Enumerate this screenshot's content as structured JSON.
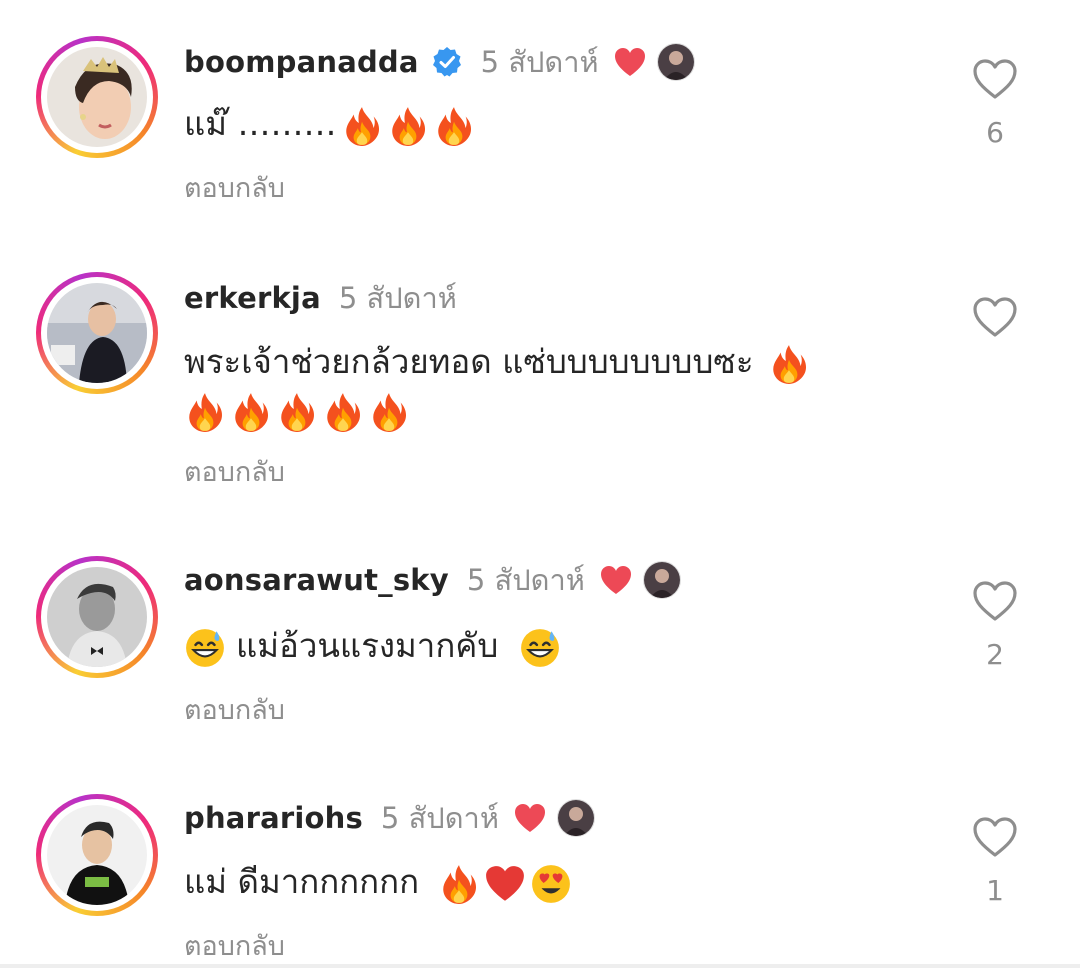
{
  "comments": [
    {
      "username": "boompanadda",
      "verified": true,
      "time": "5 สัปดาห์",
      "liked_by_author": true,
      "text": "แม๊ ………",
      "emoji": [
        "fire",
        "fire",
        "fire"
      ],
      "reply_label": "ตอบกลับ",
      "likes": "6"
    },
    {
      "username": "erkerkja",
      "verified": false,
      "time": "5 สัปดาห์",
      "liked_by_author": false,
      "text": "พระเจ้าช่วยกล้วยทอด แซ่บบบบบบบบซะ",
      "text_line2": "",
      "emoji": [
        "fire",
        "fire",
        "fire",
        "fire",
        "fire",
        "fire"
      ],
      "reply_label": "ตอบกลับ",
      "likes": ""
    },
    {
      "username": "aonsarawut_sky",
      "verified": false,
      "time": "5 สัปดาห์",
      "liked_by_author": true,
      "text": "แม่อ้วนแรงมากคับ",
      "emoji": [
        "grin-sweat",
        "grin-sweat"
      ],
      "reply_label": "ตอบกลับ",
      "likes": "2"
    },
    {
      "username": "pharariohs",
      "verified": false,
      "time": "5 สัปดาห์",
      "liked_by_author": true,
      "text": "แม่ ดีมากกกกกก",
      "emoji": [
        "fire",
        "red-heart",
        "heart-eyes"
      ],
      "reply_label": "ตอบกลับ",
      "likes": "1"
    }
  ],
  "colors": {
    "text": "#262626",
    "muted": "#8e8e8e",
    "heart": "#ed4956",
    "verified": "#3897f0"
  }
}
